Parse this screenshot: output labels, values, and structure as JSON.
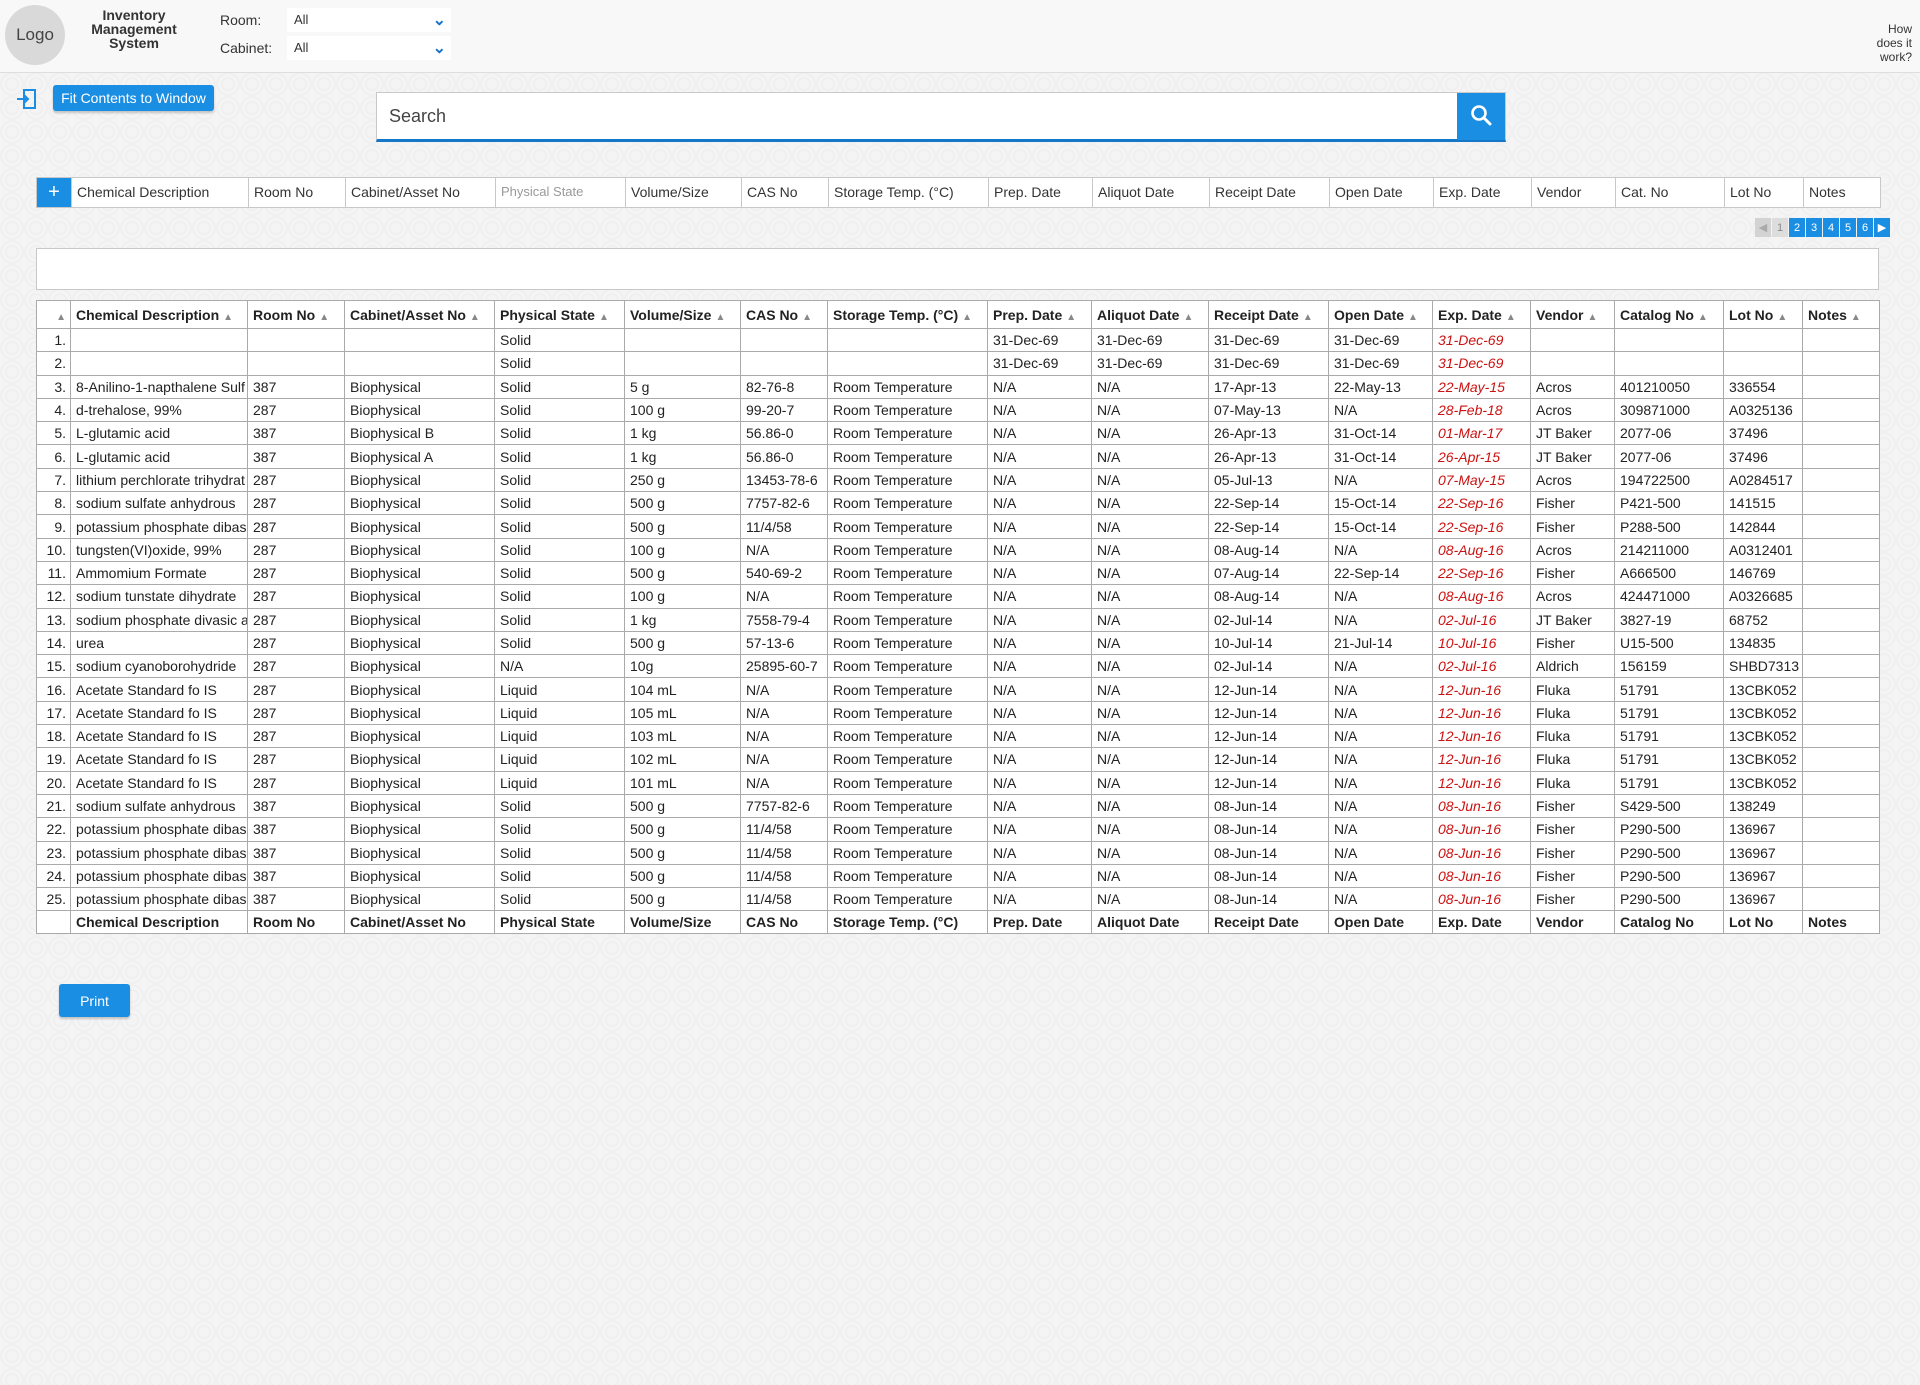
{
  "app": {
    "logo": "Logo",
    "title": "Inventory Management System",
    "help": "How does it work?"
  },
  "filters": {
    "room_label": "Room:",
    "room_value": "All",
    "cabinet_label": "Cabinet:",
    "cabinet_value": "All"
  },
  "toolbar": {
    "fit_label": "Fit Contents to Window",
    "print_label": "Print"
  },
  "search": {
    "placeholder": "Search"
  },
  "filter_row": {
    "add_label": "+",
    "fields": [
      "Chemical Description",
      "Room No",
      "Cabinet/Asset No",
      "Physical State",
      "Volume/Size",
      "CAS No",
      "Storage Temp. (°C)",
      "Prep. Date",
      "Aliquot Date",
      "Receipt Date",
      "Open Date",
      "Exp. Date",
      "Vendor",
      "Cat. No",
      "Lot No",
      "Notes"
    ]
  },
  "pagination": {
    "pages": [
      "1",
      "2",
      "3",
      "4",
      "5",
      "6"
    ],
    "current": "1"
  },
  "table": {
    "columns": [
      "Chemical Description",
      "Room No",
      "Cabinet/Asset No",
      "Physical State",
      "Volume/Size",
      "CAS No",
      "Storage Temp. (°C)",
      "Prep. Date",
      "Aliquot Date",
      "Receipt Date",
      "Open Date",
      "Exp. Date",
      "Vendor",
      "Catalog No",
      "Lot No",
      "Notes"
    ],
    "rows": [
      [
        "1.",
        "",
        "",
        "",
        "Solid",
        "",
        "",
        "",
        "31-Dec-69",
        "31-Dec-69",
        "31-Dec-69",
        "31-Dec-69",
        "31-Dec-69",
        "",
        "",
        "",
        ""
      ],
      [
        "2.",
        "",
        "",
        "",
        "Solid",
        "",
        "",
        "",
        "31-Dec-69",
        "31-Dec-69",
        "31-Dec-69",
        "31-Dec-69",
        "31-Dec-69",
        "",
        "",
        "",
        ""
      ],
      [
        "3.",
        "8-Anilino-1-napthalene Sulf",
        "387",
        "Biophysical",
        "Solid",
        "5 g",
        "82-76-8",
        "Room Temperature",
        "N/A",
        "N/A",
        "17-Apr-13",
        "22-May-13",
        "22-May-15",
        "Acros",
        "401210050",
        "336554",
        ""
      ],
      [
        "4.",
        "d-trehalose, 99%",
        "287",
        "Biophysical",
        "Solid",
        "100 g",
        "99-20-7",
        "Room Temperature",
        "N/A",
        "N/A",
        "07-May-13",
        "N/A",
        "28-Feb-18",
        "Acros",
        "309871000",
        "A0325136",
        ""
      ],
      [
        "5.",
        "L-glutamic acid",
        "387",
        "Biophysical B",
        "Solid",
        "1 kg",
        "56.86-0",
        "Room Temperature",
        "N/A",
        "N/A",
        "26-Apr-13",
        "31-Oct-14",
        "01-Mar-17",
        "JT Baker",
        "2077-06",
        "37496",
        ""
      ],
      [
        "6.",
        "L-glutamic acid",
        "387",
        "Biophysical A",
        "Solid",
        "1 kg",
        "56.86-0",
        "Room Temperature",
        "N/A",
        "N/A",
        "26-Apr-13",
        "31-Oct-14",
        "26-Apr-15",
        "JT Baker",
        "2077-06",
        "37496",
        ""
      ],
      [
        "7.",
        "lithium perchlorate trihydrat",
        "287",
        "Biophysical",
        "Solid",
        "250 g",
        "13453-78-6",
        "Room Temperature",
        "N/A",
        "N/A",
        "05-Jul-13",
        "N/A",
        "07-May-15",
        "Acros",
        "194722500",
        "A0284517",
        ""
      ],
      [
        "8.",
        "sodium sulfate anhydrous",
        "287",
        "Biophysical",
        "Solid",
        "500 g",
        "7757-82-6",
        "Room Temperature",
        "N/A",
        "N/A",
        "22-Sep-14",
        "15-Oct-14",
        "22-Sep-16",
        "Fisher",
        "P421-500",
        "141515",
        ""
      ],
      [
        "9.",
        "potassium phosphate dibas",
        "287",
        "Biophysical",
        "Solid",
        "500 g",
        "11/4/58",
        "Room Temperature",
        "N/A",
        "N/A",
        "22-Sep-14",
        "15-Oct-14",
        "22-Sep-16",
        "Fisher",
        "P288-500",
        "142844",
        ""
      ],
      [
        "10.",
        "tungsten(VI)oxide, 99%",
        "287",
        "Biophysical",
        "Solid",
        "100 g",
        "N/A",
        "Room Temperature",
        "N/A",
        "N/A",
        "08-Aug-14",
        "N/A",
        "08-Aug-16",
        "Acros",
        "214211000",
        "A0312401",
        ""
      ],
      [
        "11.",
        "Ammomium Formate",
        "287",
        "Biophysical",
        "Solid",
        "500 g",
        "540-69-2",
        "Room Temperature",
        "N/A",
        "N/A",
        "07-Aug-14",
        "22-Sep-14",
        "22-Sep-16",
        "Fisher",
        "A666500",
        "146769",
        ""
      ],
      [
        "12.",
        "sodium tunstate dihydrate",
        "287",
        "Biophysical",
        "Solid",
        "100 g",
        "N/A",
        "Room Temperature",
        "N/A",
        "N/A",
        "08-Aug-14",
        "N/A",
        "08-Aug-16",
        "Acros",
        "424471000",
        "A0326685",
        ""
      ],
      [
        "13.",
        "sodium phosphate divasic a",
        "287",
        "Biophysical",
        "Solid",
        "1 kg",
        "7558-79-4",
        "Room Temperature",
        "N/A",
        "N/A",
        "02-Jul-14",
        "N/A",
        "02-Jul-16",
        "JT Baker",
        "3827-19",
        "68752",
        ""
      ],
      [
        "14.",
        "urea",
        "287",
        "Biophysical",
        "Solid",
        "500 g",
        "57-13-6",
        "Room Temperature",
        "N/A",
        "N/A",
        "10-Jul-14",
        "21-Jul-14",
        "10-Jul-16",
        "Fisher",
        "U15-500",
        "134835",
        ""
      ],
      [
        "15.",
        "sodium cyanoborohydride",
        "287",
        "Biophysical",
        "N/A",
        "10g",
        "25895-60-7",
        "Room Temperature",
        "N/A",
        "N/A",
        "02-Jul-14",
        "N/A",
        "02-Jul-16",
        "Aldrich",
        "156159",
        "SHBD7313",
        ""
      ],
      [
        "16.",
        "Acetate Standard fo IS",
        "287",
        "Biophysical",
        "Liquid",
        "104 mL",
        "N/A",
        "Room Temperature",
        "N/A",
        "N/A",
        "12-Jun-14",
        "N/A",
        "12-Jun-16",
        "Fluka",
        "51791",
        "13CBK052",
        ""
      ],
      [
        "17.",
        "Acetate Standard fo IS",
        "287",
        "Biophysical",
        "Liquid",
        "105 mL",
        "N/A",
        "Room Temperature",
        "N/A",
        "N/A",
        "12-Jun-14",
        "N/A",
        "12-Jun-16",
        "Fluka",
        "51791",
        "13CBK052",
        ""
      ],
      [
        "18.",
        "Acetate Standard fo IS",
        "287",
        "Biophysical",
        "Liquid",
        "103 mL",
        "N/A",
        "Room Temperature",
        "N/A",
        "N/A",
        "12-Jun-14",
        "N/A",
        "12-Jun-16",
        "Fluka",
        "51791",
        "13CBK052",
        ""
      ],
      [
        "19.",
        "Acetate Standard fo IS",
        "287",
        "Biophysical",
        "Liquid",
        "102 mL",
        "N/A",
        "Room Temperature",
        "N/A",
        "N/A",
        "12-Jun-14",
        "N/A",
        "12-Jun-16",
        "Fluka",
        "51791",
        "13CBK052",
        ""
      ],
      [
        "20.",
        "Acetate Standard fo IS",
        "287",
        "Biophysical",
        "Liquid",
        "101 mL",
        "N/A",
        "Room Temperature",
        "N/A",
        "N/A",
        "12-Jun-14",
        "N/A",
        "12-Jun-16",
        "Fluka",
        "51791",
        "13CBK052",
        ""
      ],
      [
        "21.",
        "sodium sulfate anhydrous",
        "387",
        "Biophysical",
        "Solid",
        "500 g",
        "7757-82-6",
        "Room Temperature",
        "N/A",
        "N/A",
        "08-Jun-14",
        "N/A",
        "08-Jun-16",
        "Fisher",
        "S429-500",
        "138249",
        ""
      ],
      [
        "22.",
        "potassium phosphate dibas",
        "387",
        "Biophysical",
        "Solid",
        "500 g",
        "11/4/58",
        "Room Temperature",
        "N/A",
        "N/A",
        "08-Jun-14",
        "N/A",
        "08-Jun-16",
        "Fisher",
        "P290-500",
        "136967",
        ""
      ],
      [
        "23.",
        "potassium phosphate dibas",
        "387",
        "Biophysical",
        "Solid",
        "500 g",
        "11/4/58",
        "Room Temperature",
        "N/A",
        "N/A",
        "08-Jun-14",
        "N/A",
        "08-Jun-16",
        "Fisher",
        "P290-500",
        "136967",
        ""
      ],
      [
        "24.",
        "potassium phosphate dibas",
        "387",
        "Biophysical",
        "Solid",
        "500 g",
        "11/4/58",
        "Room Temperature",
        "N/A",
        "N/A",
        "08-Jun-14",
        "N/A",
        "08-Jun-16",
        "Fisher",
        "P290-500",
        "136967",
        ""
      ],
      [
        "25.",
        "potassium phosphate dibas",
        "387",
        "Biophysical",
        "Solid",
        "500 g",
        "11/4/58",
        "Room Temperature",
        "N/A",
        "N/A",
        "08-Jun-14",
        "N/A",
        "08-Jun-16",
        "Fisher",
        "P290-500",
        "136967",
        ""
      ]
    ]
  },
  "colors": {
    "accent": "#1a8ee3",
    "expired_text": "#cc1111",
    "search_underline": "#1677c8"
  },
  "icons": {
    "exit": "exit-icon",
    "search": "search-icon",
    "dropdown": "chevron-down-icon",
    "sort": "sort-up-icon",
    "next": "next-page-icon",
    "prev": "prev-page-icon"
  }
}
